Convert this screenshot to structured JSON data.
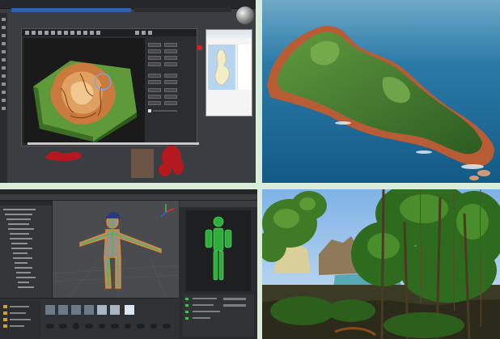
{
  "palette": {
    "page_bg": "#d9ecd9",
    "editor_bg": "#3a3d42",
    "dialog_bg": "#2b2d30",
    "terrain_green": "#5e9a3a",
    "terrain_brown": "#c97a3c",
    "ocean": "#1f6f9a",
    "sky": "#d6e9f2",
    "rig_bg": "#2f3033",
    "skeleton_green": "#3cc04a",
    "forest_sky": "#9fc7ea",
    "forest_green": "#2e6b1e"
  },
  "panels": {
    "terrain_editor": {
      "name": "terrain-editor-screenshot",
      "icon": "terrain-mesh-icon"
    },
    "island": {
      "name": "island-aerial-render",
      "icon": "island-icon"
    },
    "rig_editor": {
      "name": "character-rig-editor-screenshot",
      "icon": "character-rig-icon"
    },
    "forest": {
      "name": "jungle-scene-render",
      "icon": "tree-icon"
    }
  }
}
